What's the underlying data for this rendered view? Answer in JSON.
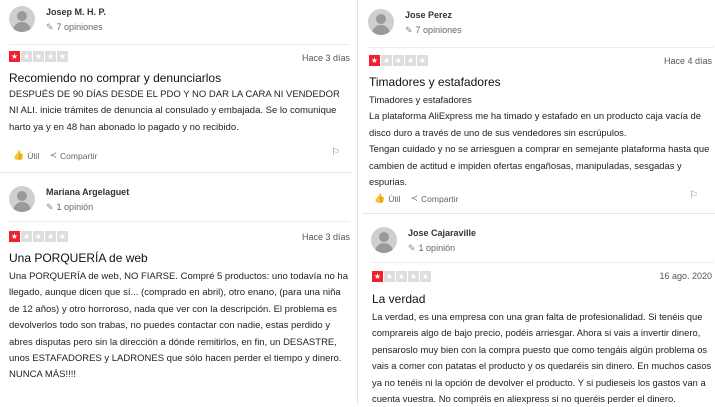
{
  "reviews": [
    {
      "user": "Josep M. H. P.",
      "opinions": "7 opiniones",
      "rating": 1,
      "date": "Hace 3 días",
      "title": "Recomiendo no comprar y denunciarlos",
      "body": [
        "DESPUÉS DE 90 DÍAS DESDE EL PDO Y NO DAR LA CARA NI VENDEDOR NI ALI. inicie trámites de denuncia al consulado y embajada. Se lo comunique harto ya y en 48 han abonado lo pagado y no recibido."
      ],
      "useful_label": "Útil",
      "share_label": "Compartir"
    },
    {
      "user": "Mariana Argelaguet",
      "opinions": "1 opinión",
      "rating": 1,
      "date": "Hace 3 días",
      "title": "Una PORQUERÍA de web",
      "body": [
        "Una PORQUERÍA de web, NO FIARSE. Compré 5 productos: uno todavía no ha llegado, aunque dicen que sí... (comprado en abril), otro enano, (para una niña de 12 años) y otro horroroso, nada que ver con la descripción. El problema es devolverlos todo son trabas, no puedes contactar con nadie, estas perdido y abres disputas pero sin la dirección a dónde remitirlos, en fin, un DESASTRE, unos ESTAFADORES y LADRONES que sólo hacen perder el tiempo y dinero. NUNCA MÁS!!!!"
      ]
    },
    {
      "user": "Jose Perez",
      "opinions": "7 opiniones",
      "rating": 1,
      "date": "Hace 4 días",
      "title": "Timadores y estafadores",
      "body": [
        "Timadores y estafadores",
        "La plataforma AliExpress me ha timado y estafado en un producto caja vacía de disco duro a través de uno de sus vendedores sin escrúpulos.",
        "Tengan cuidado y no se arriesguen a comprar en semejante plataforma hasta que cambien de actitud e impiden ofertas engañosas, manipuladas, sesgadas y espurias."
      ],
      "useful_label": "Útil",
      "share_label": "Compartir"
    },
    {
      "user": "Jose Cajaraville",
      "opinions": "1 opinión",
      "rating": 1,
      "date": "16 ago. 2020",
      "title": "La verdad",
      "body": [
        "La verdad, es una empresa con una gran falta de profesionalidad. Si tenéis que comprareis algo de bajo precio, podéis arriesgar. Ahora si vais a invertir dinero, pensaroslo muy bien con la compra puesto que como tengáis algún problema os vais a comer con patatas el producto y os quedaréis sin dinero. En muchos casos ya no tenéis ni la opción de devolver el producto. Y si pudieseis los gastos van a cuenta vuestra. No compréis en aliexpress si no queréis perder el dinero."
      ]
    }
  ],
  "colors": {
    "star_on": "#f0202d",
    "star_off": "#dedede"
  }
}
